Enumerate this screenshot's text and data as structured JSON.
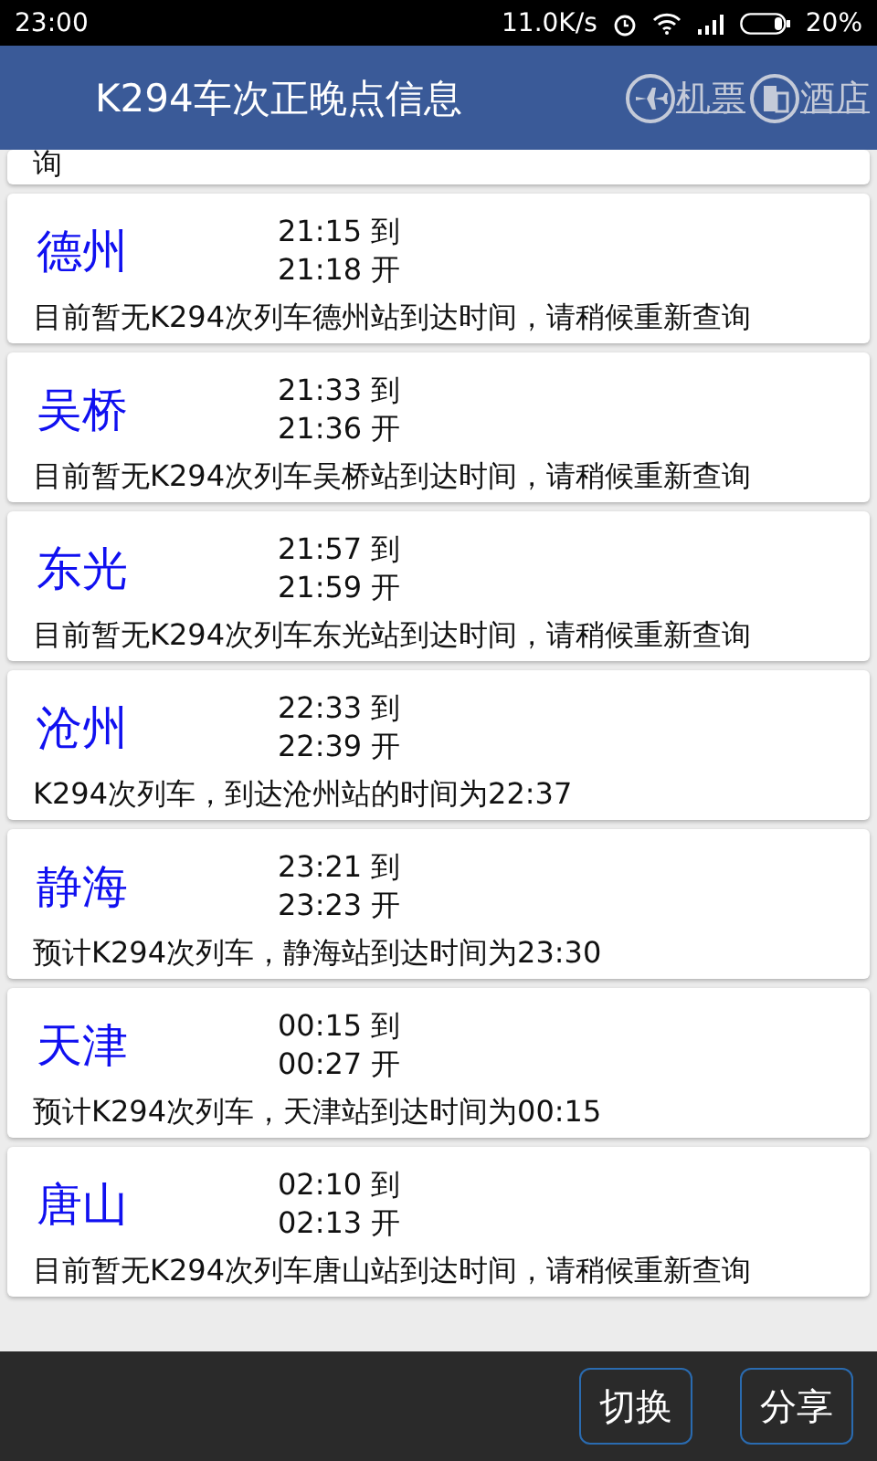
{
  "status_bar": {
    "time": "23:00",
    "speed": "11.0K/s",
    "battery": "20%"
  },
  "header": {
    "title": "K294车次正晚点信息",
    "links": [
      {
        "kind": "plane",
        "label": "机票"
      },
      {
        "kind": "hotel",
        "label": "酒店"
      }
    ]
  },
  "top_partial_text": "询",
  "stops": [
    {
      "station": "德州",
      "arrive": "21:15 到",
      "depart": "21:18 开",
      "message": "目前暂无K294次列车德州站到达时间，请稍候重新查询"
    },
    {
      "station": "吴桥",
      "arrive": "21:33 到",
      "depart": "21:36 开",
      "message": "目前暂无K294次列车吴桥站到达时间，请稍候重新查询"
    },
    {
      "station": "东光",
      "arrive": "21:57 到",
      "depart": "21:59 开",
      "message": "目前暂无K294次列车东光站到达时间，请稍候重新查询"
    },
    {
      "station": "沧州",
      "arrive": "22:33 到",
      "depart": "22:39 开",
      "message": "K294次列车，到达沧州站的时间为22:37"
    },
    {
      "station": "静海",
      "arrive": "23:21 到",
      "depart": "23:23 开",
      "message": "预计K294次列车，静海站到达时间为23:30"
    },
    {
      "station": "天津",
      "arrive": "00:15 到",
      "depart": "00:27 开",
      "message": "预计K294次列车，天津站到达时间为00:15"
    },
    {
      "station": "唐山",
      "arrive": "02:10 到",
      "depart": "02:13 开",
      "message": "目前暂无K294次列车唐山站到达时间，请稍候重新查询"
    }
  ],
  "bottom_buttons": [
    "切换",
    "分享"
  ]
}
